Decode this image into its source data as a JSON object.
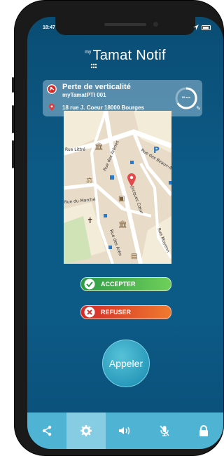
{
  "status": {
    "time": "18:47"
  },
  "logo": {
    "prefix": "my",
    "text": "Tamat Notif"
  },
  "alert": {
    "title": "Perte de verticalité",
    "device": "myTamatPTI 001",
    "address": "18 rue J. Coeur 18000 Bourges",
    "timer": "09 sec"
  },
  "map": {
    "streets": [
      "Rue Littré",
      "Rue des Arènes",
      "Rue des Beaux-A",
      "Rue du Marché",
      "Jacques Cœur",
      "Rue Moyenn",
      "Rue des Arèn"
    ],
    "parking_label": "P"
  },
  "actions": {
    "accept": "ACCEPTER",
    "refuse": "REFUSER"
  },
  "call": {
    "label": "Appeler"
  },
  "bottombar": {
    "items": [
      "share-icon",
      "gear-icon",
      "speaker-icon",
      "mic-off-icon",
      "lock-icon"
    ],
    "active_index": 1
  },
  "colors": {
    "accent": "#4fb4d4",
    "accept": "#2e9a46",
    "refuse": "#d32a2a",
    "background": "#0c5a86"
  }
}
